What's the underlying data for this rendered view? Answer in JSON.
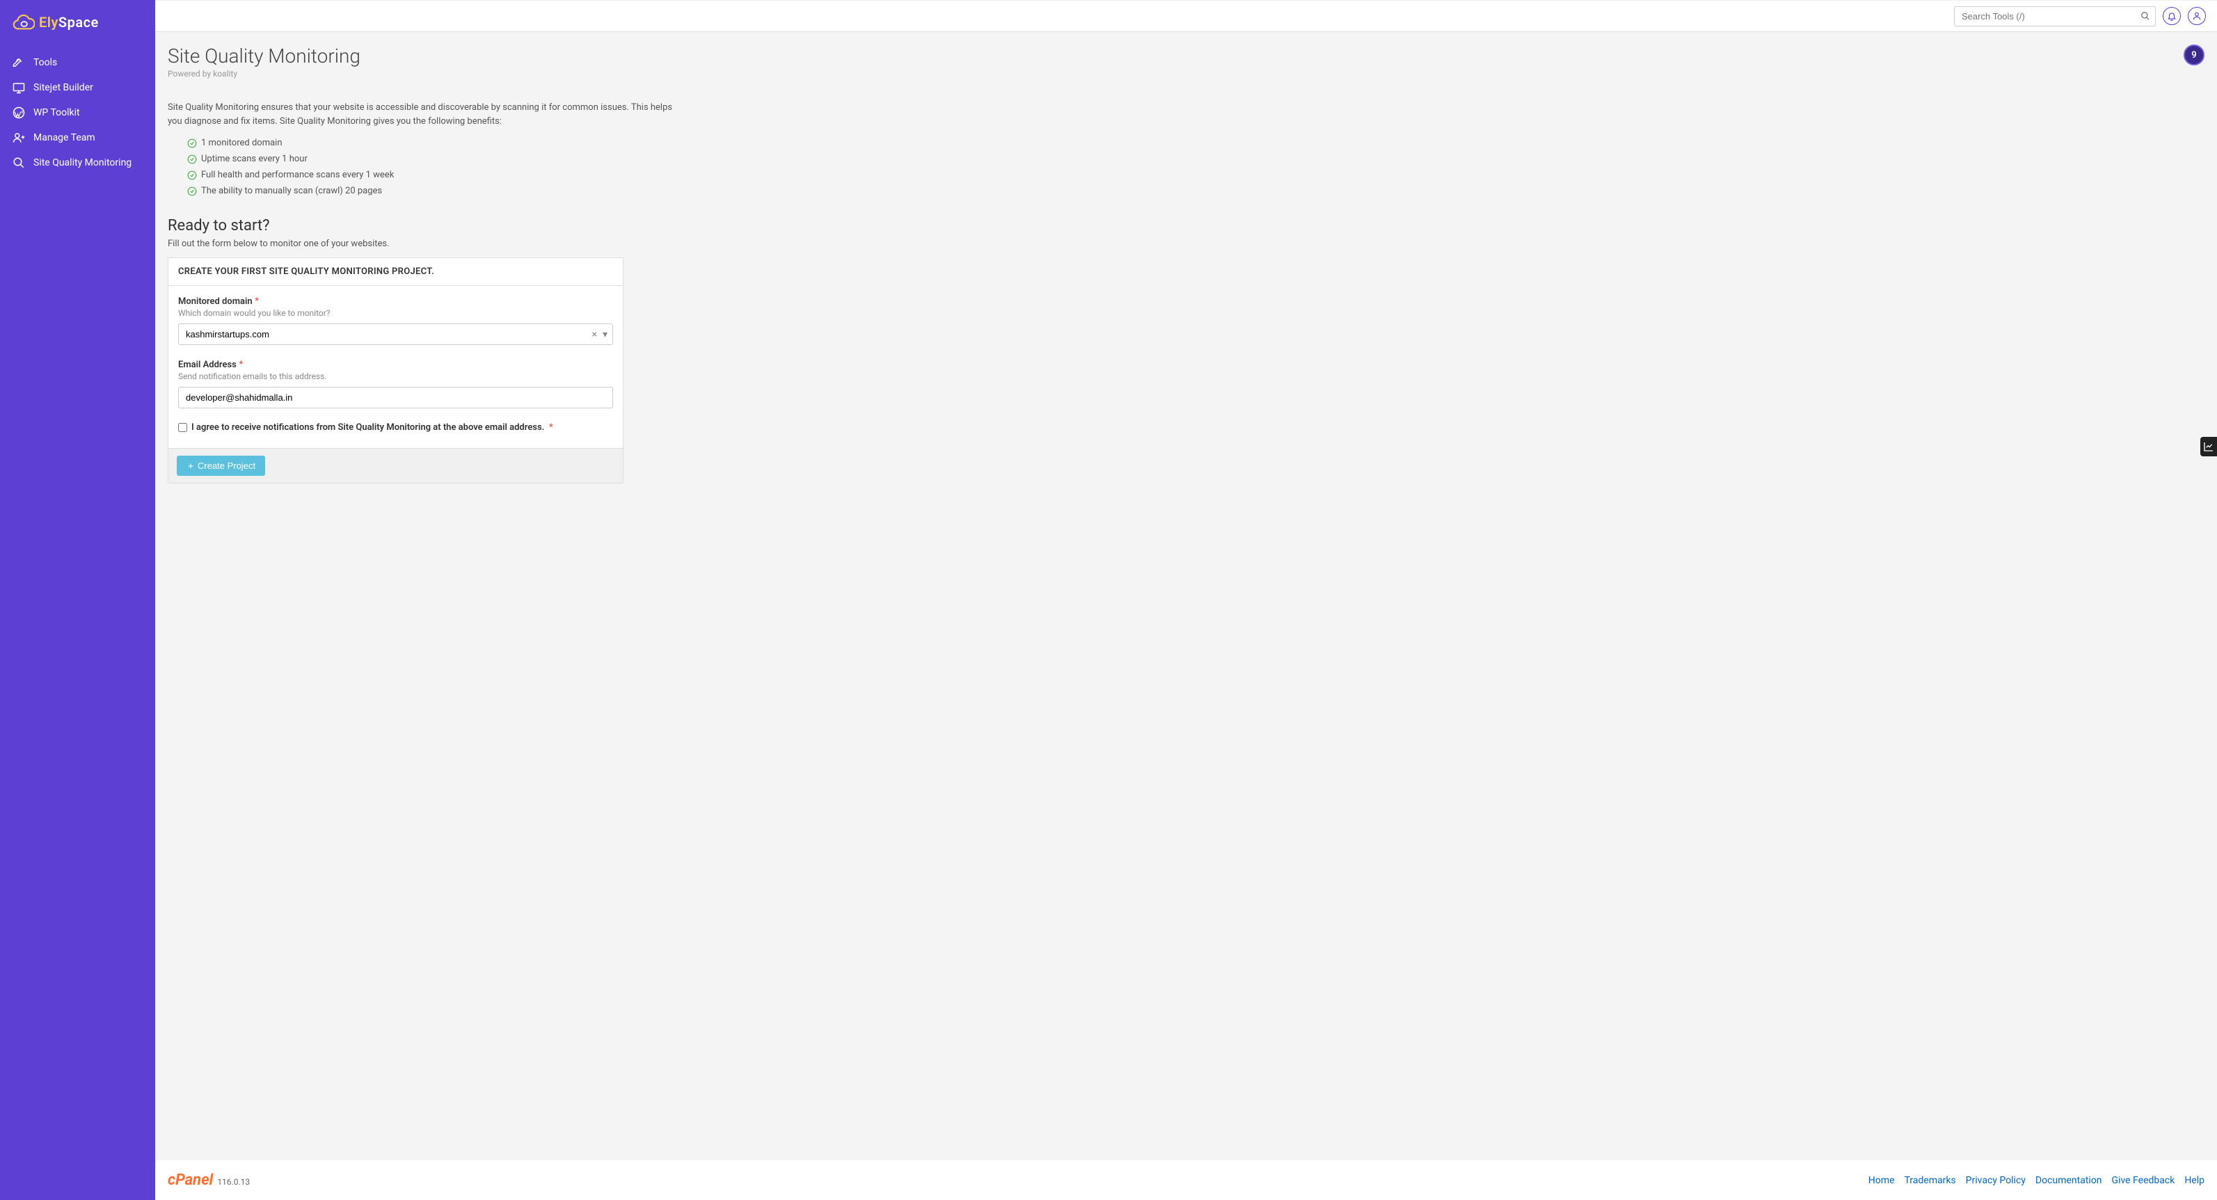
{
  "brand": {
    "name_part1": "Ely",
    "name_part2": "Space"
  },
  "sidebar": {
    "items": [
      {
        "label": "Tools"
      },
      {
        "label": "Sitejet Builder"
      },
      {
        "label": "WP Toolkit"
      },
      {
        "label": "Manage Team"
      },
      {
        "label": "Site Quality Monitoring"
      }
    ]
  },
  "topbar": {
    "search_placeholder": "Search Tools (/)"
  },
  "page": {
    "title": "Site Quality Monitoring",
    "subtitle": "Powered by koality",
    "badge": "9",
    "description": "Site Quality Monitoring ensures that your website is accessible and discoverable by scanning it for common issues. This helps you diagnose and fix items. Site Quality Monitoring gives you the following benefits:",
    "benefits": [
      "1 monitored domain",
      "Uptime scans every 1 hour",
      "Full health and performance scans every 1 week",
      "The ability to manually scan (crawl) 20 pages"
    ],
    "ready_title": "Ready to start?",
    "ready_sub": "Fill out the form below to monitor one of your websites."
  },
  "form": {
    "panel_header": "CREATE YOUR FIRST SITE QUALITY MONITORING PROJECT.",
    "domain_label": "Monitored domain",
    "domain_hint": "Which domain would you like to monitor?",
    "domain_value": "kashmirstartups.com",
    "email_label": "Email Address",
    "email_hint": "Send notification emails to this address.",
    "email_value": "developer@shahidmalla.in",
    "agree_label": "I agree to receive notifications from Site Quality Monitoring at the above email address.",
    "create_button": "Create Project"
  },
  "footer": {
    "cpanel": "cPanel",
    "version": "116.0.13",
    "links": [
      "Home",
      "Trademarks",
      "Privacy Policy",
      "Documentation",
      "Give Feedback",
      "Help"
    ]
  }
}
